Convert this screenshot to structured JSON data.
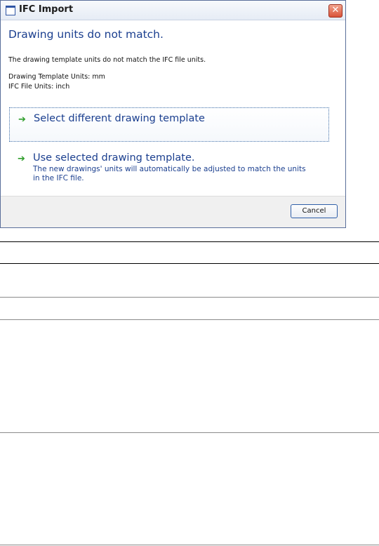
{
  "window": {
    "title": "IFC Import",
    "close_glyph": "✕",
    "app_icon": "window-icon"
  },
  "content": {
    "heading": "Drawing units do not match.",
    "description": "The drawing template units do not match the IFC file units.",
    "template_units": "Drawing Template Units: mm",
    "file_units": "IFC File Units: inch"
  },
  "options": [
    {
      "arrow": "➔",
      "title": "Select different drawing template",
      "subtitle": ""
    },
    {
      "arrow": "➔",
      "title": "Use selected drawing template.",
      "subtitle": "The new drawings' units will automatically be adjusted to match the units in the IFC file."
    }
  ],
  "footer": {
    "cancel_label": "Cancel"
  },
  "colors": {
    "heading": "#1b3f8f",
    "arrow": "#2e9d2a",
    "close": "#d9533a"
  }
}
